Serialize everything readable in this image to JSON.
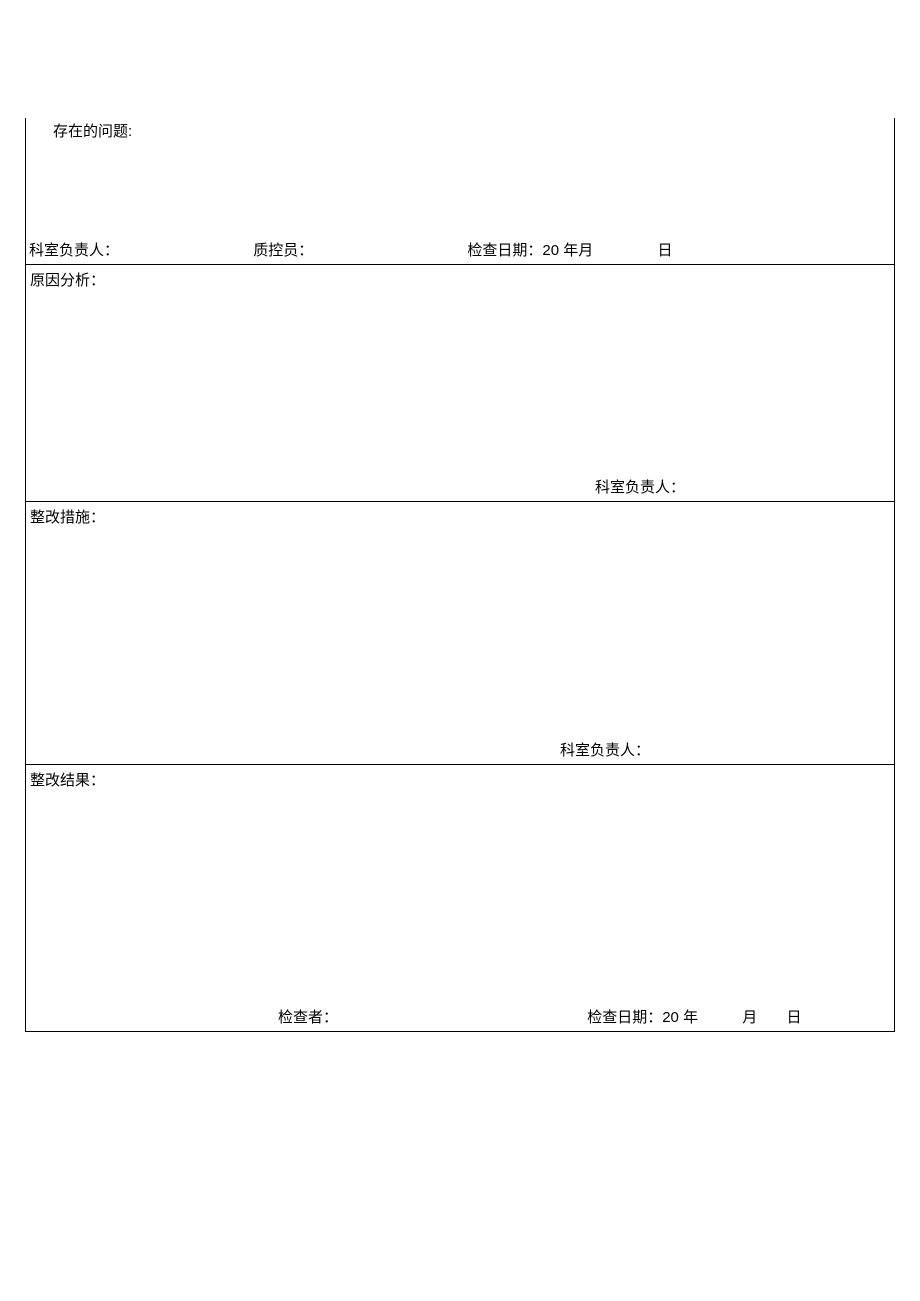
{
  "sections": {
    "problems": {
      "label": "存在的问题:",
      "dept_head": "科室负责人：",
      "qc_officer": "质控员：",
      "check_date_prefix": "检查日期：",
      "year_prefix": "20",
      "year_suffix": "年",
      "month_suffix": "月",
      "day_suffix": "日"
    },
    "analysis": {
      "label": "原因分析：",
      "dept_head": "科室负责人："
    },
    "measures": {
      "label": "整改措施：",
      "dept_head": "科室负责人："
    },
    "results": {
      "label": "整改结果：",
      "checker": "检查者：",
      "check_date_prefix": "检查日期：",
      "year_prefix": "20",
      "year_suffix": "年",
      "month_suffix": "月",
      "day_suffix": "日"
    }
  }
}
